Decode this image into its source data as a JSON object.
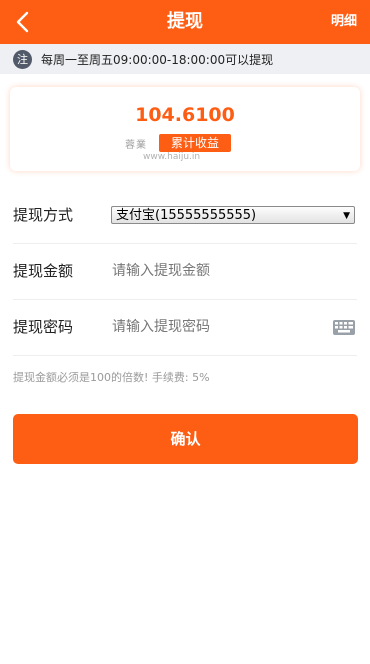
{
  "header": {
    "title": "提现",
    "right_link": "明细",
    "back_icon": "chevron-left-icon"
  },
  "notice": {
    "icon_text": "注",
    "text": "每周一至周五09:00:00-18:00:00可以提现"
  },
  "summary": {
    "amount": "104.6100",
    "label": "累计收益",
    "watermark_line1": "蓉業",
    "watermark_line2": "www.haiju.in"
  },
  "form": {
    "method_label": "提现方式",
    "method_value": "支付宝(15555555555)",
    "amount_label": "提现金额",
    "amount_placeholder": "请输入提现金额",
    "password_label": "提现密码",
    "password_placeholder": "请输入提现密码",
    "keyboard_icon": "keyboard-icon"
  },
  "hint": "提现金额必须是100的倍数! 手续费: 5%",
  "confirm_label": "确认",
  "colors": {
    "brand": "#fe5d14",
    "notice_bg": "#eef0f3",
    "hint_text": "#9a9a9a"
  }
}
